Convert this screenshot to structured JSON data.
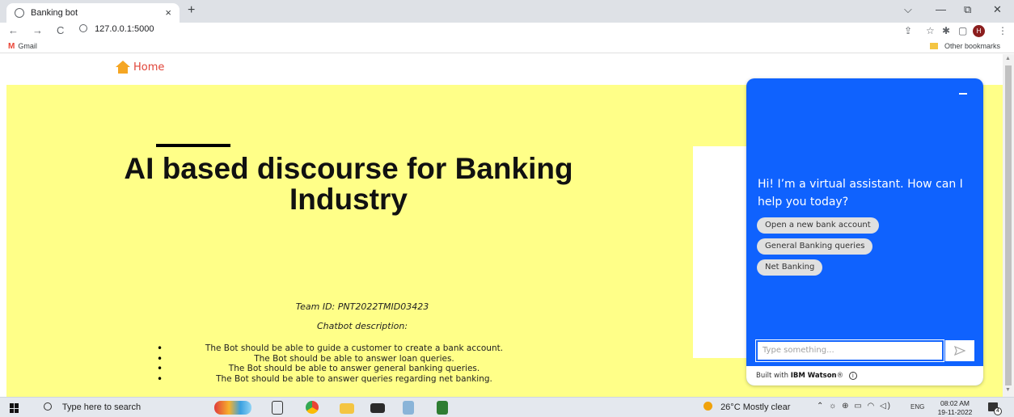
{
  "browser": {
    "tab_title": "Banking bot",
    "tab_close": "×",
    "new_tab": "+",
    "window_controls": {
      "dropdown": "⌵",
      "minimize": "—",
      "restore": "⧉",
      "close": "✕"
    },
    "nav": {
      "back": "←",
      "forward": "→",
      "reload": "C"
    },
    "url": "127.0.0.1:5000",
    "toolbar_icons": [
      "share-icon",
      "star-icon",
      "extensions-icon",
      "sidebar-icon",
      "profile-icon",
      "menu-icon"
    ],
    "profile_initial": "H",
    "menu": "⋮",
    "bookmarks": {
      "gmail": "Gmail",
      "other": "Other bookmarks"
    }
  },
  "page": {
    "home_link": "Home",
    "hero": {
      "title": "AI based discourse for Banking Industry",
      "team_id": "Team ID: PNT2022TMID03423",
      "chatbot_description_heading": "Chatbot description:",
      "bullets": [
        "The Bot should be able to guide a customer to create a bank account.",
        "The Bot should be able to answer loan queries.",
        "The Bot should be able to answer general banking queries.",
        "The Bot should be able to answer queries regarding net banking."
      ]
    },
    "chat": {
      "greeting": "Hi! I’m a virtual assistant. How can I help you today?",
      "options": [
        "Open a new bank account",
        "General Banking queries",
        "Net Banking"
      ],
      "input_placeholder": "Type something...",
      "footer_prefix": "Built with",
      "footer_brand": "IBM Watson",
      "footer_mark": "®",
      "info_icon": "i",
      "accent_color": "#0f62fe"
    }
  },
  "taskbar": {
    "search_placeholder": "Type here to search",
    "weather": "26°C  Mostly clear",
    "language": "ENG",
    "time": "08:02 AM",
    "date": "19-11-2022",
    "notification_count": "4"
  }
}
